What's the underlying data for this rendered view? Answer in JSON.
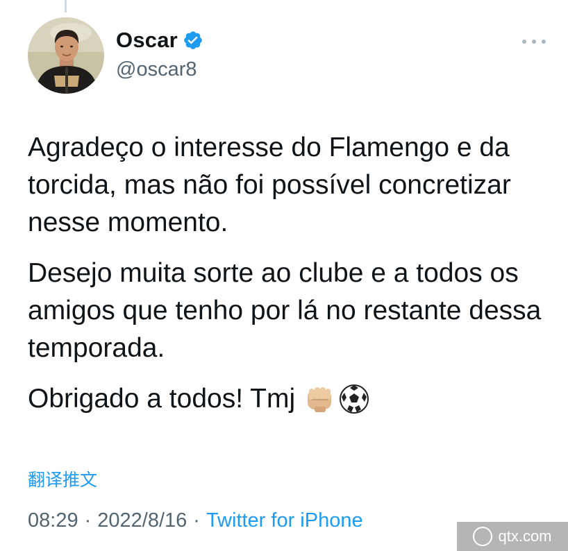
{
  "author": {
    "display_name": "Oscar",
    "handle": "@oscar8",
    "verified": true
  },
  "tweet": {
    "paragraphs": [
      "Agradeço o interesse do Flamengo e da torcida, mas não foi possível concretizar nesse momento.",
      "Desejo muita sorte ao clube e a todos os amigos que tenho por lá no restante dessa temporada."
    ],
    "last_line": "Obrigado a todos! Tmj",
    "emojis": [
      "fist-bump-emoji",
      "soccer-ball-emoji"
    ]
  },
  "translate_label": "翻译推文",
  "meta": {
    "time": "08:29",
    "date": "2022/8/16",
    "separator": "·",
    "source": "Twitter for iPhone"
  },
  "watermark": {
    "text": "qtx.com"
  },
  "colors": {
    "link": "#1d9bf0",
    "secondary_text": "#536471",
    "primary_text": "#0f1419",
    "verified": "#1d9bf0"
  }
}
